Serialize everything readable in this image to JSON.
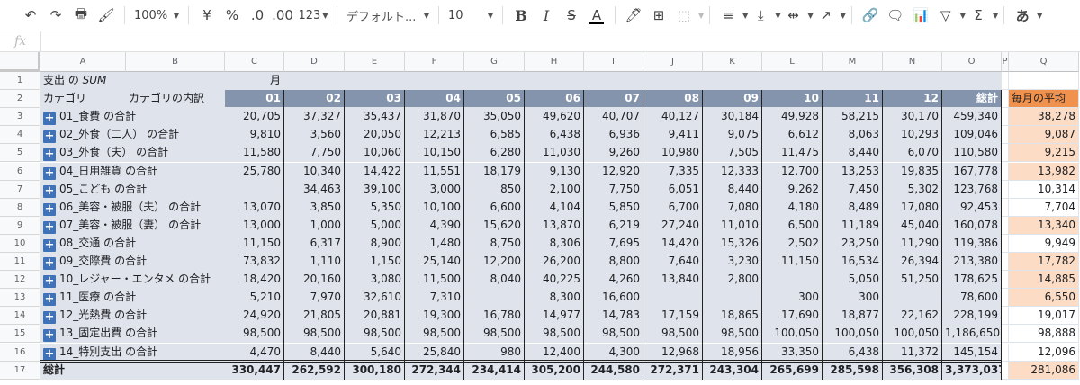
{
  "toolbar": {
    "zoom": "100%",
    "currency": "¥",
    "percent": "%",
    "dec_less": ".0",
    "dec_more": ".00",
    "format_more": "123",
    "font": "デフォルト...",
    "font_size": "10",
    "bold": "B",
    "italic": "I",
    "strike": "S",
    "text_color": "A",
    "input_mode": "あ"
  },
  "formula_bar": {
    "fx": "fx",
    "value": ""
  },
  "columns": [
    "A",
    "B",
    "C",
    "D",
    "E",
    "F",
    "G",
    "H",
    "I",
    "J",
    "K",
    "L",
    "M",
    "N",
    "O",
    "P",
    "Q"
  ],
  "row_numbers": [
    "1",
    "2",
    "3",
    "4",
    "5",
    "6",
    "7",
    "8",
    "9",
    "10",
    "11",
    "12",
    "13",
    "14",
    "15",
    "16",
    "17"
  ],
  "pivot": {
    "title_prefix": "支出 の ",
    "title_sum": "SUM",
    "month_label": "月",
    "col_category": "カテゴリ",
    "col_breakdown": "カテゴリの内訳",
    "months": [
      "01",
      "02",
      "03",
      "04",
      "05",
      "06",
      "07",
      "08",
      "09",
      "10",
      "11",
      "12"
    ],
    "total_label": "総計",
    "avg_label": "毎月の平均",
    "rows": [
      {
        "label": "01_食費 の合計",
        "values": [
          "20,705",
          "37,327",
          "35,437",
          "31,870",
          "35,050",
          "49,620",
          "40,707",
          "40,127",
          "30,184",
          "49,928",
          "58,215",
          "30,170"
        ],
        "total": "459,340",
        "avg": "38,278",
        "avg_hi": true
      },
      {
        "label": "02_外食（二人） の合計",
        "values": [
          "9,810",
          "3,560",
          "20,050",
          "12,213",
          "6,585",
          "6,438",
          "6,936",
          "9,411",
          "9,075",
          "6,612",
          "8,063",
          "10,293"
        ],
        "total": "109,046",
        "avg": "9,087",
        "avg_hi": true
      },
      {
        "label": "03_外食（夫） の合計",
        "values": [
          "11,580",
          "7,750",
          "10,060",
          "10,150",
          "6,280",
          "11,030",
          "9,260",
          "10,980",
          "7,505",
          "11,475",
          "8,440",
          "6,070"
        ],
        "total": "110,580",
        "avg": "9,215",
        "avg_hi": true
      },
      {
        "label": "04_日用雑貨 の合計",
        "values": [
          "25,780",
          "10,340",
          "14,422",
          "11,551",
          "18,179",
          "9,130",
          "12,920",
          "7,335",
          "12,333",
          "12,700",
          "13,253",
          "19,835"
        ],
        "total": "167,778",
        "avg": "13,982",
        "avg_hi": true
      },
      {
        "label": "05_こども の合計",
        "values": [
          "",
          "34,463",
          "39,100",
          "3,000",
          "850",
          "2,100",
          "7,750",
          "6,051",
          "8,440",
          "9,262",
          "7,450",
          "5,302"
        ],
        "total": "123,768",
        "avg": "10,314",
        "avg_hi": false
      },
      {
        "label": "06_美容・被服（夫） の合計",
        "values": [
          "13,070",
          "3,850",
          "5,350",
          "10,100",
          "6,600",
          "4,104",
          "5,850",
          "6,700",
          "7,080",
          "4,180",
          "8,489",
          "17,080"
        ],
        "total": "92,453",
        "avg": "7,704",
        "avg_hi": false
      },
      {
        "label": "07_美容・被服（妻） の合計",
        "values": [
          "13,000",
          "1,000",
          "5,000",
          "4,390",
          "15,620",
          "13,870",
          "6,219",
          "27,240",
          "11,010",
          "6,500",
          "11,189",
          "45,040"
        ],
        "total": "160,078",
        "avg": "13,340",
        "avg_hi": true
      },
      {
        "label": "08_交通 の合計",
        "values": [
          "11,150",
          "6,317",
          "8,900",
          "1,480",
          "8,750",
          "8,306",
          "7,695",
          "14,420",
          "15,326",
          "2,502",
          "23,250",
          "11,290"
        ],
        "total": "119,386",
        "avg": "9,949",
        "avg_hi": false
      },
      {
        "label": "09_交際費 の合計",
        "values": [
          "73,832",
          "1,110",
          "1,150",
          "25,140",
          "12,200",
          "26,200",
          "8,800",
          "7,640",
          "3,230",
          "11,150",
          "16,534",
          "26,394"
        ],
        "total": "213,380",
        "avg": "17,782",
        "avg_hi": true
      },
      {
        "label": "10_レジャー・エンタメ の合計",
        "values": [
          "18,420",
          "20,160",
          "3,080",
          "11,500",
          "8,040",
          "40,225",
          "4,260",
          "13,840",
          "2,800",
          "",
          "5,050",
          "51,250"
        ],
        "total": "178,625",
        "avg": "14,885",
        "avg_hi": true
      },
      {
        "label": "11_医療 の合計",
        "values": [
          "5,210",
          "7,970",
          "32,610",
          "7,310",
          "",
          "8,300",
          "16,600",
          "",
          "",
          "300",
          "300",
          ""
        ],
        "total": "78,600",
        "avg": "6,550",
        "avg_hi": true
      },
      {
        "label": "12_光熱費 の合計",
        "values": [
          "24,920",
          "21,805",
          "20,881",
          "19,300",
          "16,780",
          "14,977",
          "14,783",
          "17,159",
          "18,865",
          "17,690",
          "18,877",
          "22,162"
        ],
        "total": "228,199",
        "avg": "19,017",
        "avg_hi": false
      },
      {
        "label": "13_固定出費 の合計",
        "values": [
          "98,500",
          "98,500",
          "98,500",
          "98,500",
          "98,500",
          "98,500",
          "98,500",
          "98,500",
          "98,500",
          "100,050",
          "100,050",
          "100,050"
        ],
        "total": "1,186,650",
        "avg": "98,888",
        "avg_hi": false
      },
      {
        "label": "14_特別支出 の合計",
        "values": [
          "4,470",
          "8,440",
          "5,640",
          "25,840",
          "980",
          "12,400",
          "4,300",
          "12,968",
          "18,956",
          "33,350",
          "6,438",
          "11,372"
        ],
        "total": "145,154",
        "avg": "12,096",
        "avg_hi": false
      }
    ],
    "grand": {
      "label": "総計",
      "values": [
        "330,447",
        "262,592",
        "300,180",
        "272,344",
        "234,414",
        "305,200",
        "244,580",
        "272,371",
        "243,304",
        "265,699",
        "285,598",
        "356,308"
      ],
      "total": "3,373,037",
      "avg": "281,086"
    }
  }
}
